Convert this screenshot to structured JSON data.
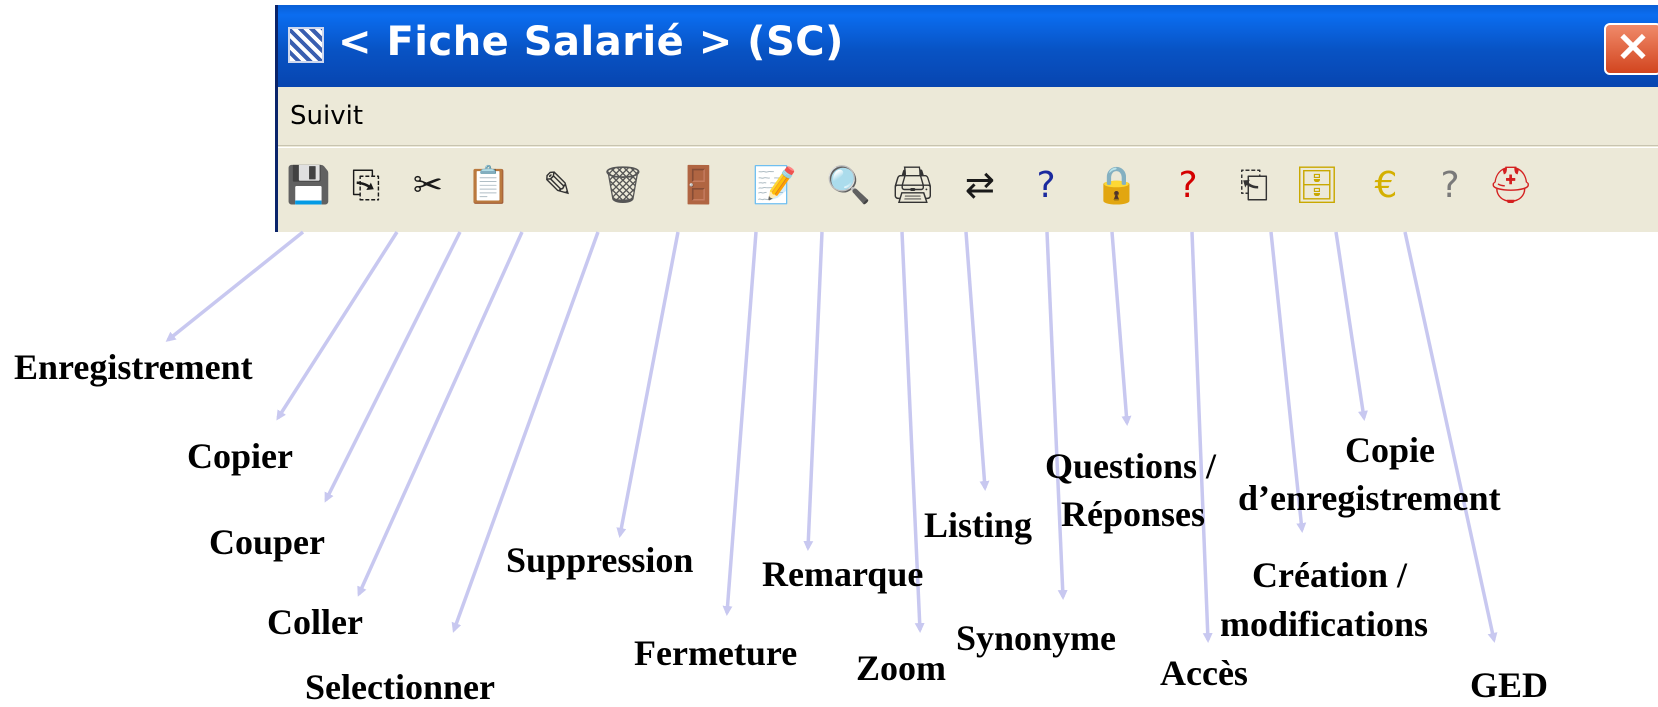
{
  "window": {
    "title": "< Fiche Salarié > (SC)",
    "close_glyph": "✕",
    "menu": [
      "Suivit"
    ]
  },
  "toolbar": [
    {
      "icon": "save-icon",
      "glyph": "💾",
      "color": "#2b2b2b"
    },
    {
      "icon": "copy-icon",
      "glyph": "⎘",
      "color": "#1a1a1a"
    },
    {
      "icon": "scissors-icon",
      "glyph": "✂",
      "color": "#1a1a1a"
    },
    {
      "icon": "paste-icon",
      "glyph": "📋",
      "color": "#5a4b2a"
    },
    {
      "icon": "select-icon",
      "glyph": "✎",
      "color": "#333333"
    },
    {
      "icon": "trash-icon",
      "glyph": "🗑",
      "color": "#555555"
    },
    {
      "icon": "door-icon",
      "glyph": "🚪",
      "color": "#1b2a9e"
    },
    {
      "icon": "note-icon",
      "glyph": "📝",
      "color": "#c9a800"
    },
    {
      "icon": "zoom-icon",
      "glyph": "🔍",
      "color": "#222222"
    },
    {
      "icon": "printer-icon",
      "glyph": "🖨",
      "color": "#333333"
    },
    {
      "icon": "synonym-icon",
      "glyph": "⇄",
      "color": "#1a1a1a"
    },
    {
      "icon": "question-doc-icon",
      "glyph": "?",
      "color": "#1b2a9e"
    },
    {
      "icon": "lock-icon",
      "glyph": "🔒",
      "color": "#d4a800"
    },
    {
      "icon": "question-person-icon",
      "glyph": "?",
      "color": "#d40000"
    },
    {
      "icon": "copy-record-icon",
      "glyph": "⎗",
      "color": "#333333"
    },
    {
      "icon": "cabinet-icon",
      "glyph": "🗄",
      "color": "#c9a800"
    },
    {
      "icon": "euro-icon",
      "glyph": "€",
      "color": "#d4b000"
    },
    {
      "icon": "help-icon",
      "glyph": "?",
      "color": "#7a7a7a"
    },
    {
      "icon": "lifebuoy-icon",
      "glyph": "⛑",
      "color": "#d42020"
    }
  ],
  "labels": [
    "Enregistrement",
    "Copier",
    "Couper",
    "Coller",
    "Selectionner",
    "Suppression",
    "Fermeture",
    "Remarque",
    "Zoom",
    "Listing",
    "Synonyme",
    "Questions /",
    "Réponses",
    "Accès",
    "?",
    "Copie",
    "d’enregistrement",
    "Création /",
    "modifications",
    "GED"
  ],
  "colors": {
    "arrow": "#c8c8f0",
    "titlebar": "#0853c4",
    "window_bg": "#ece9d8"
  }
}
